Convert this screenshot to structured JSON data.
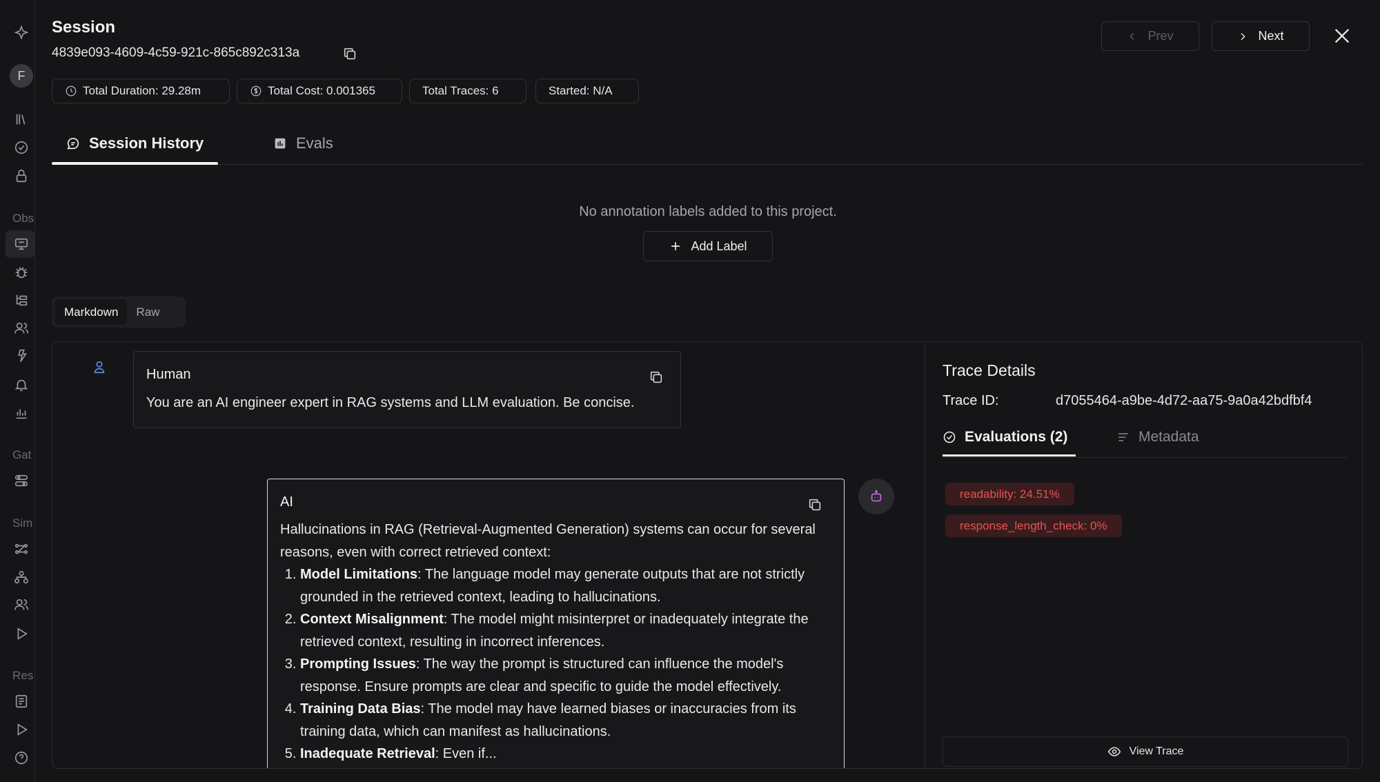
{
  "sidebar": {
    "avatar_initial": "F",
    "sections": {
      "obs": "Obs",
      "gat": "Gat",
      "sim": "Sim",
      "res": "Res"
    }
  },
  "session": {
    "title": "Session",
    "id": "4839e093-4609-4c59-921c-865c892c313a",
    "chips": {
      "duration": "Total Duration: 29.28m",
      "cost": "Total Cost: 0.001365",
      "traces": "Total Traces: 6",
      "started": "Started: N/A"
    },
    "prev_label": "Prev",
    "next_label": "Next"
  },
  "tabs": {
    "history": "Session History",
    "evals": "Evals"
  },
  "annotations": {
    "empty_text": "No annotation labels added to this project.",
    "add_label": "Add Label"
  },
  "view_toggle": {
    "markdown": "Markdown",
    "raw": "Raw"
  },
  "messages": {
    "human": {
      "role": "Human",
      "text": "You are an AI engineer expert in RAG systems and LLM evaluation. Be concise."
    },
    "ai": {
      "role": "AI",
      "intro": "Hallucinations in RAG (Retrieval-Augmented Generation) systems can occur for several reasons, even with correct retrieved context:",
      "items": [
        {
          "title": "Model Limitations",
          "text": ": The language model may generate outputs that are not strictly grounded in the retrieved context, leading to hallucinations."
        },
        {
          "title": "Context Misalignment",
          "text": ": The model might misinterpret or inadequately integrate the retrieved context, resulting in incorrect inferences."
        },
        {
          "title": "Prompting Issues",
          "text": ": The way the prompt is structured can influence the model's response. Ensure prompts are clear and specific to guide the model effectively."
        },
        {
          "title": "Training Data Bias",
          "text": ": The model may have learned biases or inaccuracies from its training data, which can manifest as hallucinations."
        },
        {
          "title": "Inadequate Retrieval",
          "text": ": Even if..."
        }
      ]
    }
  },
  "trace": {
    "title": "Trace Details",
    "id_label": "Trace ID:",
    "id_value": "d7055464-a9be-4d72-aa75-9a0a42bdfbf4",
    "tabs": {
      "evaluations": "Evaluations (2)",
      "metadata": "Metadata"
    },
    "badges": [
      "readability: 24.51%",
      "response_length_check: 0%"
    ],
    "view_trace": "View Trace"
  },
  "colors": {
    "background": "#151517",
    "badge_text": "#e8534c",
    "badge_bg": "#3a1c1e",
    "robot_accent": "#c66ae0",
    "human_icon": "#5b8ee6"
  },
  "icons": [
    "logo-icon",
    "library-icon",
    "check-circle-icon",
    "lock-icon",
    "monitor-icon",
    "bug-icon",
    "tree-icon",
    "users-icon",
    "sparkle-icon",
    "bell-icon",
    "bar-chart-icon",
    "sliders-icon",
    "flow-icon",
    "org-icon",
    "play-icon",
    "list-icon",
    "help-icon",
    "copy-icon",
    "clock-icon",
    "dollar-icon",
    "close-icon",
    "chat-icon",
    "chart-icon",
    "plus-icon",
    "user-icon",
    "robot-icon",
    "eye-icon"
  ]
}
